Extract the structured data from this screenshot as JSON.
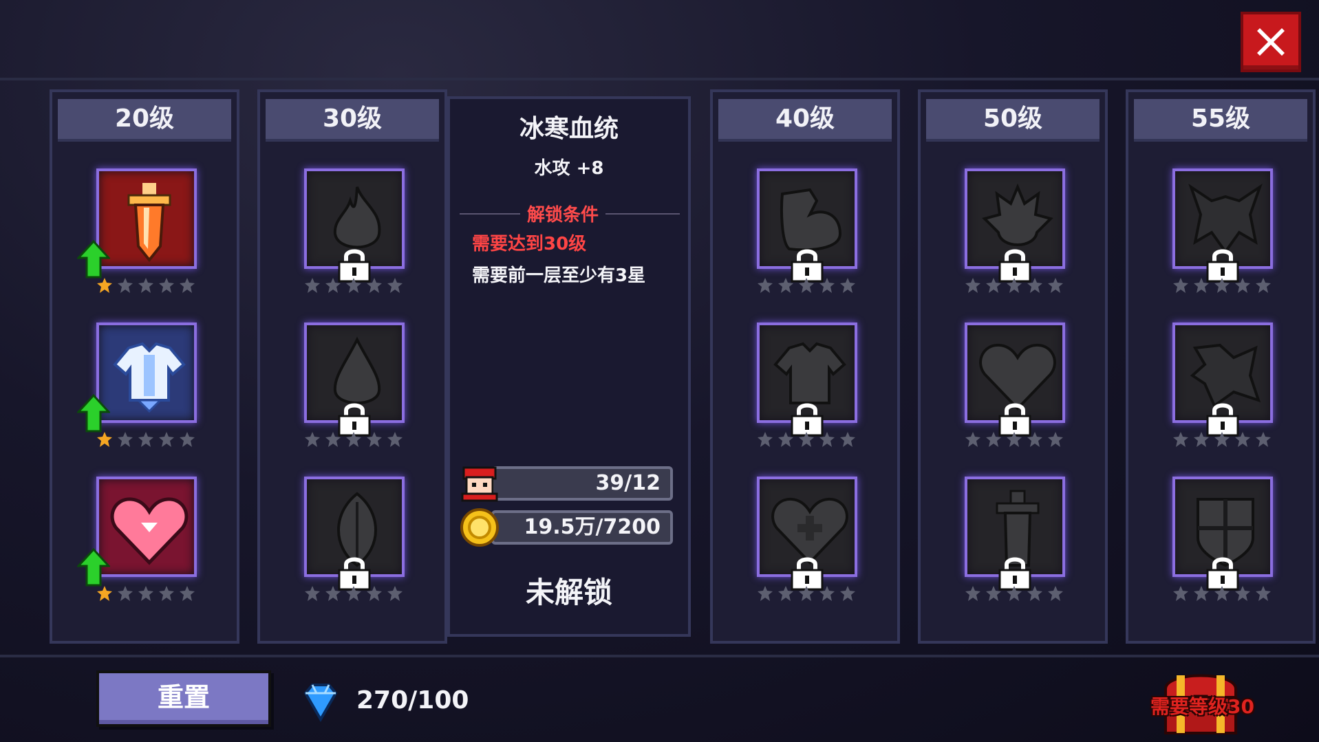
{
  "colors": {
    "accent_purple": "#8b6ee0",
    "close_red": "#c8191d",
    "requirement_red": "#ff4545",
    "upgrade_green": "#2bd02b",
    "star_gold": "#f5a623"
  },
  "close_button": {
    "icon": "close-icon"
  },
  "columns": [
    {
      "level": "20级",
      "skills": [
        {
          "icon": "sword-icon",
          "locked": false,
          "stars_filled": 1,
          "upgradable": true
        },
        {
          "icon": "armor-icon",
          "locked": false,
          "stars_filled": 1,
          "upgradable": true
        },
        {
          "icon": "heart-icon",
          "locked": false,
          "stars_filled": 1,
          "upgradable": true
        }
      ]
    },
    {
      "level": "30级",
      "skills": [
        {
          "icon": "flame-icon",
          "locked": true,
          "stars_filled": 0
        },
        {
          "icon": "water-drop-icon",
          "locked": true,
          "stars_filled": 0
        },
        {
          "icon": "leaf-icon",
          "locked": true,
          "stars_filled": 0
        }
      ]
    },
    {
      "level": "40级",
      "skills": [
        {
          "icon": "muscle-arm-icon",
          "locked": true,
          "stars_filled": 0
        },
        {
          "icon": "chest-armor-icon",
          "locked": true,
          "stars_filled": 0
        },
        {
          "icon": "heart-plus-icon",
          "locked": true,
          "stars_filled": 0
        }
      ]
    },
    {
      "level": "50级",
      "skills": [
        {
          "icon": "fire-spirit-icon",
          "locked": true,
          "stars_filled": 0
        },
        {
          "icon": "heart-icon",
          "locked": true,
          "stars_filled": 0
        },
        {
          "icon": "sword-icon",
          "locked": true,
          "stars_filled": 0
        }
      ]
    },
    {
      "level": "55级",
      "skills": [
        {
          "icon": "demon-icon",
          "locked": true,
          "stars_filled": 0
        },
        {
          "icon": "beast-icon",
          "locked": true,
          "stars_filled": 0
        },
        {
          "icon": "shield-icon",
          "locked": true,
          "stars_filled": 0
        }
      ]
    }
  ],
  "detail": {
    "title": "冰寒血统",
    "effect": "水攻 +8",
    "unlock_title": "解锁条件",
    "requirements": [
      "需要达到30级",
      "需要前一层至少有3星"
    ],
    "resource_1": {
      "icon": "hero-portrait-icon",
      "value": "39/12"
    },
    "resource_2": {
      "icon": "gold-coin-icon",
      "value": "19.5万/7200"
    },
    "status": "未解锁"
  },
  "footer": {
    "reset_label": "重置",
    "gem_icon": "blue-gem-icon",
    "gem_count": "270/100",
    "chest_icon": "treasure-chest-icon",
    "chest_label": "需要等级30"
  }
}
